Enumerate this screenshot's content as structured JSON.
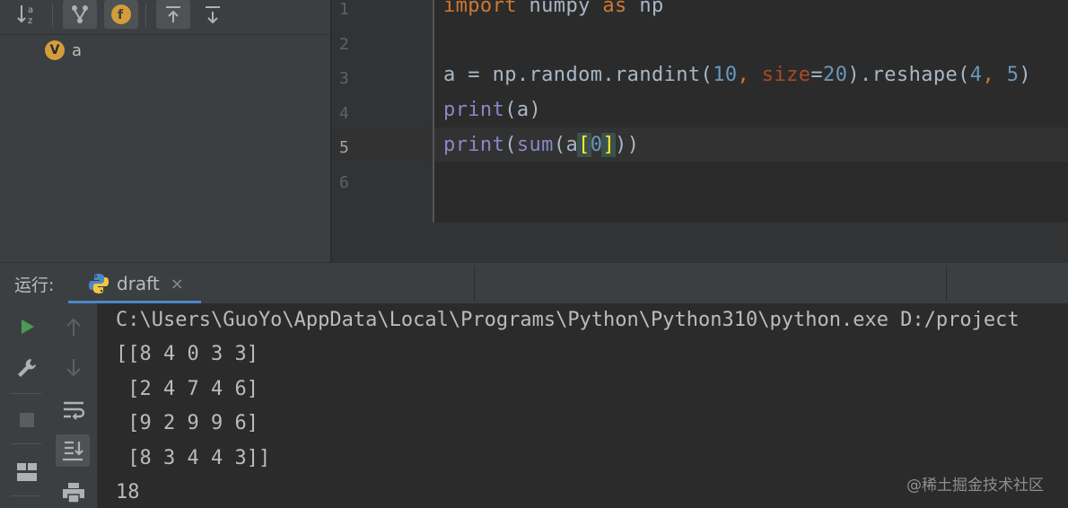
{
  "structure": {
    "tree_item": {
      "badge": "V",
      "label": "a"
    }
  },
  "editor": {
    "line_numbers": [
      "1",
      "2",
      "3",
      "4",
      "5",
      "6"
    ],
    "lines": [
      [
        {
          "t": "import",
          "c": "kw"
        },
        {
          "t": " numpy ",
          "c": ""
        },
        {
          "t": "as",
          "c": "kw"
        },
        {
          "t": " np",
          "c": ""
        }
      ],
      [],
      [
        {
          "t": "a = np.random.randint(",
          "c": ""
        },
        {
          "t": "10",
          "c": "num"
        },
        {
          "t": ", ",
          "c": "kw"
        },
        {
          "t": "size",
          "c": "kwarg"
        },
        {
          "t": "=",
          "c": ""
        },
        {
          "t": "20",
          "c": "num"
        },
        {
          "t": ").reshape(",
          "c": ""
        },
        {
          "t": "4",
          "c": "num"
        },
        {
          "t": ", ",
          "c": "kw"
        },
        {
          "t": "5",
          "c": "num"
        },
        {
          "t": ")",
          "c": ""
        }
      ],
      [
        {
          "t": "print",
          "c": "bi"
        },
        {
          "t": "(a)",
          "c": ""
        }
      ],
      [
        {
          "t": "print",
          "c": "bi"
        },
        {
          "t": "(",
          "c": ""
        },
        {
          "t": "sum",
          "c": "bi"
        },
        {
          "t": "(a",
          "c": ""
        },
        {
          "t": "[",
          "c": "brk"
        },
        {
          "t": "0",
          "c": "num"
        },
        {
          "t": "",
          "c": "caret"
        },
        {
          "t": "]",
          "c": "brk"
        },
        {
          "t": "))",
          "c": ""
        }
      ],
      []
    ]
  },
  "run": {
    "label": "运行:",
    "tab": {
      "name": "draft",
      "close": "×"
    },
    "output": [
      "C:\\Users\\GuoYo\\AppData\\Local\\Programs\\Python\\Python310\\python.exe D:/project",
      "[[8 4 0 3 3]",
      " [2 4 7 4 6]",
      " [9 2 9 9 6]",
      " [8 3 4 4 3]]",
      "18"
    ]
  },
  "watermark": "@稀土掘金技术社区",
  "colors": {
    "accent": "#4a88c7",
    "run_green": "#499c54",
    "keyword": "#cc7832",
    "number": "#6897bb",
    "builtin": "#8888c6"
  }
}
